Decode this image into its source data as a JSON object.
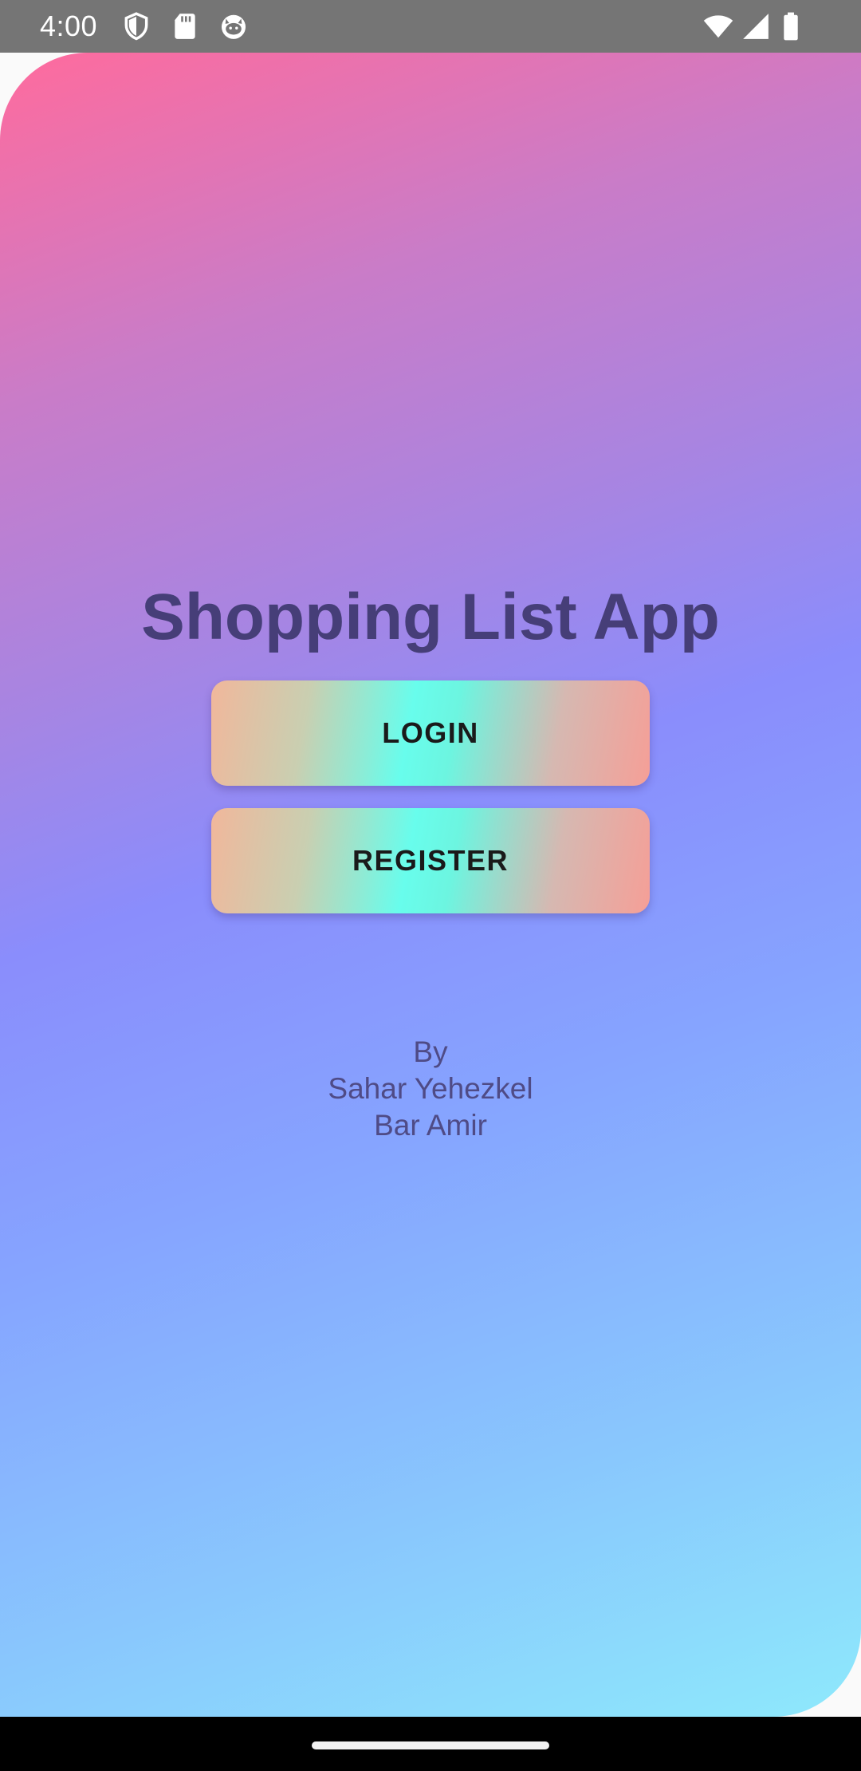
{
  "status_bar": {
    "time": "4:00",
    "left_icons": [
      "shield-icon",
      "sd-card-icon",
      "cat-face-icon"
    ],
    "right_icons": [
      "wifi-icon",
      "cellular-signal-icon",
      "battery-icon"
    ],
    "background_color": "#757575"
  },
  "app": {
    "title": "Shopping List App",
    "login_button": {
      "label": "LOGIN"
    },
    "register_button": {
      "label": "REGISTER"
    },
    "credits": {
      "by": "By",
      "author_1": "Sahar Yehezkel",
      "author_2": "Bar Amir"
    },
    "colors": {
      "title": "#463e78",
      "credits": "#4f4b86",
      "gradient_top": "#ff6b9d",
      "gradient_middle": "#8a8dfc",
      "gradient_bottom": "#8ee9fc",
      "button_edges": "#f1b79b",
      "button_center": "#68fdec"
    }
  },
  "nav_bar": {
    "handle": "home-gesture-handle"
  }
}
